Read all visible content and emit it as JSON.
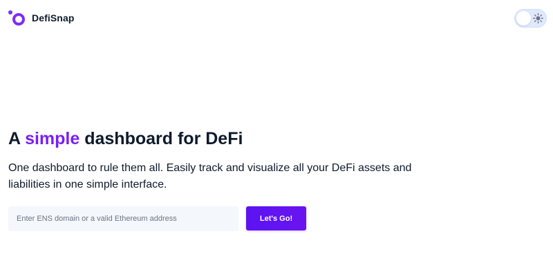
{
  "header": {
    "brand_name": "DefiSnap",
    "theme_toggle": {
      "icon": "sun-icon",
      "state": "light"
    }
  },
  "hero": {
    "headline_prefix": "A ",
    "headline_accent": "simple",
    "headline_suffix": " dashboard for DeFi",
    "subtitle": "One dashboard to rule them all. Easily track and visualize all your DeFi assets and liabilities in one simple interface."
  },
  "search": {
    "placeholder": "Enter ENS domain or a valid Ethereum address",
    "value": "",
    "button_label": "Let's Go!"
  },
  "colors": {
    "brand_purple": "#7b2ff7",
    "accent_text": "#7a1ff0",
    "button": "#5b13f2",
    "text": "#0e1a2b"
  }
}
